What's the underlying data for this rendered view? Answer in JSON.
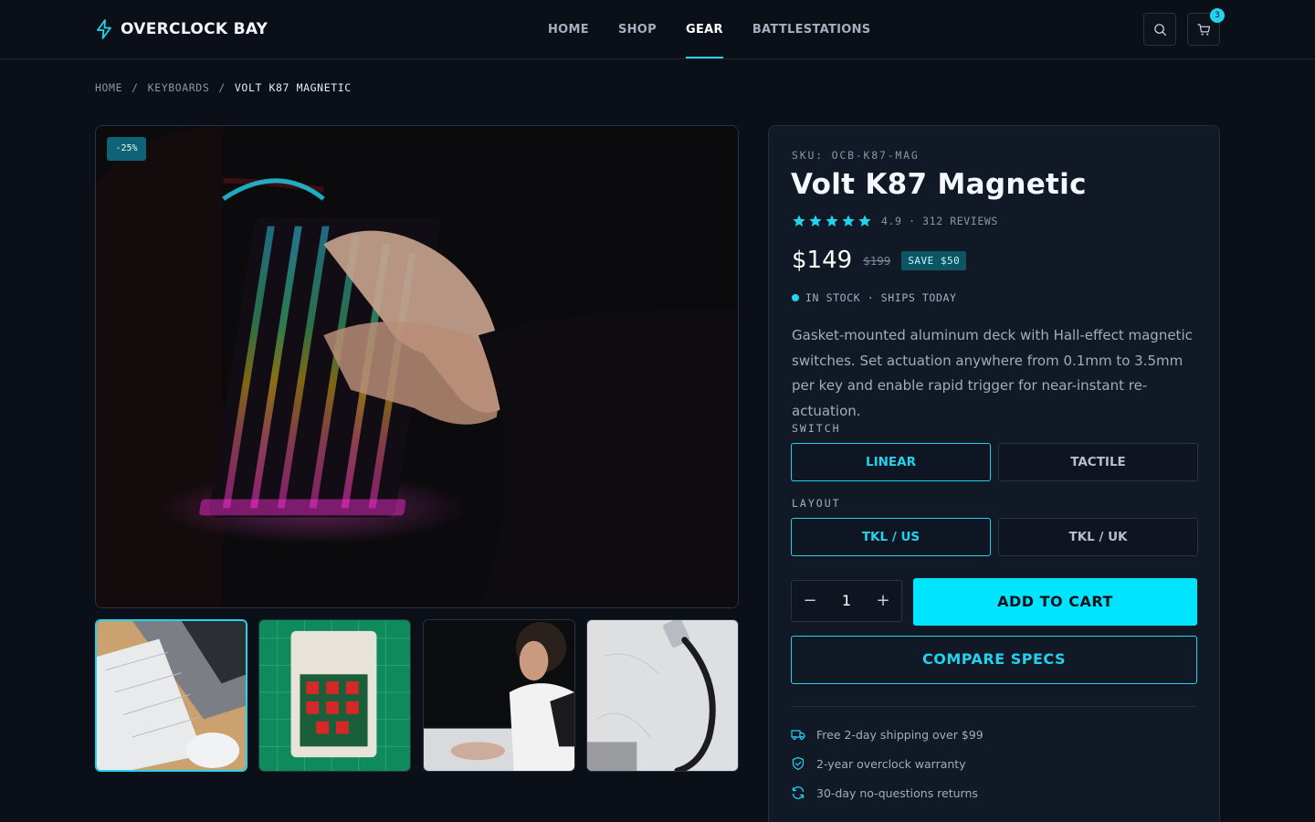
{
  "brand": {
    "name": "OVERCLOCK BAY",
    "accent": "#22d3ee"
  },
  "nav": {
    "items": [
      {
        "label": "HOME"
      },
      {
        "label": "SHOP"
      },
      {
        "label": "GEAR",
        "active": true
      },
      {
        "label": "BATTLESTATIONS"
      }
    ]
  },
  "header": {
    "cart_count": "3"
  },
  "breadcrumb": {
    "items": [
      "HOME",
      "KEYBOARDS",
      "VOLT K87 MAGNETIC"
    ],
    "separator": "/"
  },
  "gallery": {
    "discount_badge": "-25%",
    "thumbnails_count": 4
  },
  "product": {
    "sku": "SKU: OCB-K87-MAG",
    "title": "Volt K87 Magnetic",
    "rating": 4.9,
    "rating_text": "4.9 · 312 REVIEWS",
    "price": "$149",
    "old_price": "$199",
    "save_badge": "SAVE $50",
    "stock": "IN STOCK · SHIPS TODAY",
    "description": "Gasket-mounted aluminum deck with Hall-effect magnetic switches. Set actuation anywhere from 0.1mm to 3.5mm per key and enable rapid trigger for near-instant re-actuation."
  },
  "options": {
    "switch": {
      "label": "SWITCH",
      "choices": [
        "LINEAR",
        "TACTILE"
      ],
      "selected": "LINEAR"
    },
    "layout": {
      "label": "LAYOUT",
      "choices": [
        "TKL / US",
        "TKL / UK"
      ],
      "selected": "TKL / US"
    }
  },
  "purchase": {
    "quantity": "1",
    "minus": "−",
    "plus": "+",
    "add_to_cart": "ADD TO CART",
    "compare": "COMPARE SPECS"
  },
  "perks": [
    {
      "icon": "truck-icon",
      "text": "Free 2-day shipping over $99"
    },
    {
      "icon": "shield-check-icon",
      "text": "2-year overclock warranty"
    },
    {
      "icon": "refresh-icon",
      "text": "30-day no-questions returns"
    }
  ]
}
